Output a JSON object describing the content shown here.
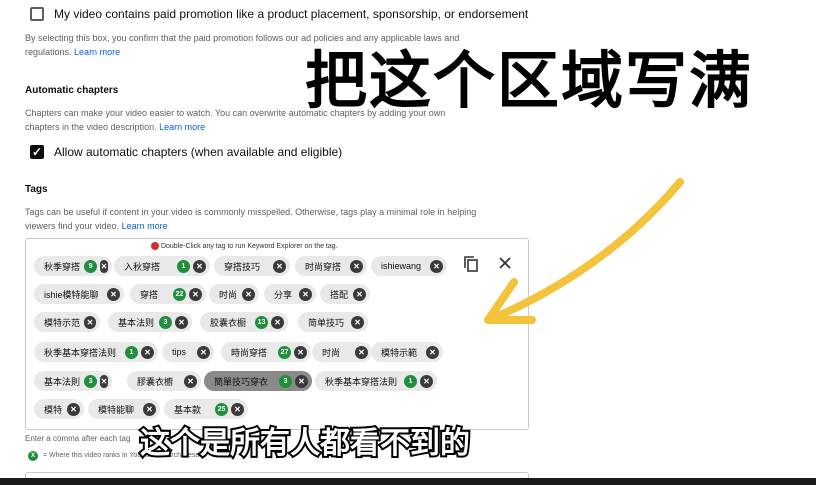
{
  "paid_promotion": {
    "checkbox_label": "My video contains paid promotion like a product placement, sponsorship, or endorsement",
    "description": "By selecting this box, you confirm that the paid promotion follows our ad policies and any applicable laws and regulations.",
    "learn_more": "Learn more"
  },
  "chapters": {
    "heading": "Automatic chapters",
    "description_line1": "Chapters can make your video easier to watch. You can overwrite automatic chapters by adding your own",
    "description_line2": "chapters in the video description.",
    "learn_more": "Learn more",
    "checkbox_label": "Allow automatic chapters (when available and eligible)"
  },
  "tags": {
    "heading": "Tags",
    "description_line1": "Tags can be useful if content in your video is commonly misspelled. Otherwise, tags play a minimal role in helping",
    "description_line2": "viewers find your video.",
    "learn_more": "Learn more",
    "hint": "Double-Click any tag to run Keyword Explorer on the tag.",
    "chips": [
      {
        "label": "秋季穿搭",
        "rank": "9"
      },
      {
        "label": "入秋穿搭",
        "rank": "1"
      },
      {
        "label": "穿搭技巧",
        "rank": ""
      },
      {
        "label": "时尚穿搭",
        "rank": ""
      },
      {
        "label": "ishiewang",
        "rank": ""
      },
      {
        "label": "ishie模特能聊",
        "rank": ""
      },
      {
        "label": "穿搭",
        "rank": "22"
      },
      {
        "label": "时尚",
        "rank": ""
      },
      {
        "label": "分享",
        "rank": ""
      },
      {
        "label": "搭配",
        "rank": ""
      },
      {
        "label": "模特示范",
        "rank": ""
      },
      {
        "label": "基本法则",
        "rank": "3"
      },
      {
        "label": "胶囊衣橱",
        "rank": "13"
      },
      {
        "label": "简单技巧",
        "rank": ""
      },
      {
        "label": "秋季基本穿搭法则",
        "rank": "1"
      },
      {
        "label": "tips",
        "rank": ""
      },
      {
        "label": "時尚穿搭",
        "rank": "27"
      },
      {
        "label": "时尚",
        "rank": ""
      },
      {
        "label": "模特示範",
        "rank": ""
      },
      {
        "label": "基本法則",
        "rank": "3"
      },
      {
        "label": "膠囊衣櫥",
        "rank": ""
      },
      {
        "label": "簡單技巧穿衣",
        "rank": "3"
      },
      {
        "label": "秋季基本穿搭法則",
        "rank": "1"
      },
      {
        "label": "模特",
        "rank": ""
      },
      {
        "label": "模特能聊",
        "rank": ""
      },
      {
        "label": "基本款",
        "rank": "25"
      }
    ],
    "footer_hint": "Enter a comma after each tag",
    "rank_legend": "= Where this video ranks in YouTube Search Results",
    "rank_legend_sample": "X"
  },
  "overlay": {
    "title": "把这个区域写满",
    "subtitle": "这个是所有人都看不到的"
  },
  "colors": {
    "rank_badge": "#1f8e3d",
    "link": "#065fd4",
    "arrow": "#f2c33b"
  }
}
